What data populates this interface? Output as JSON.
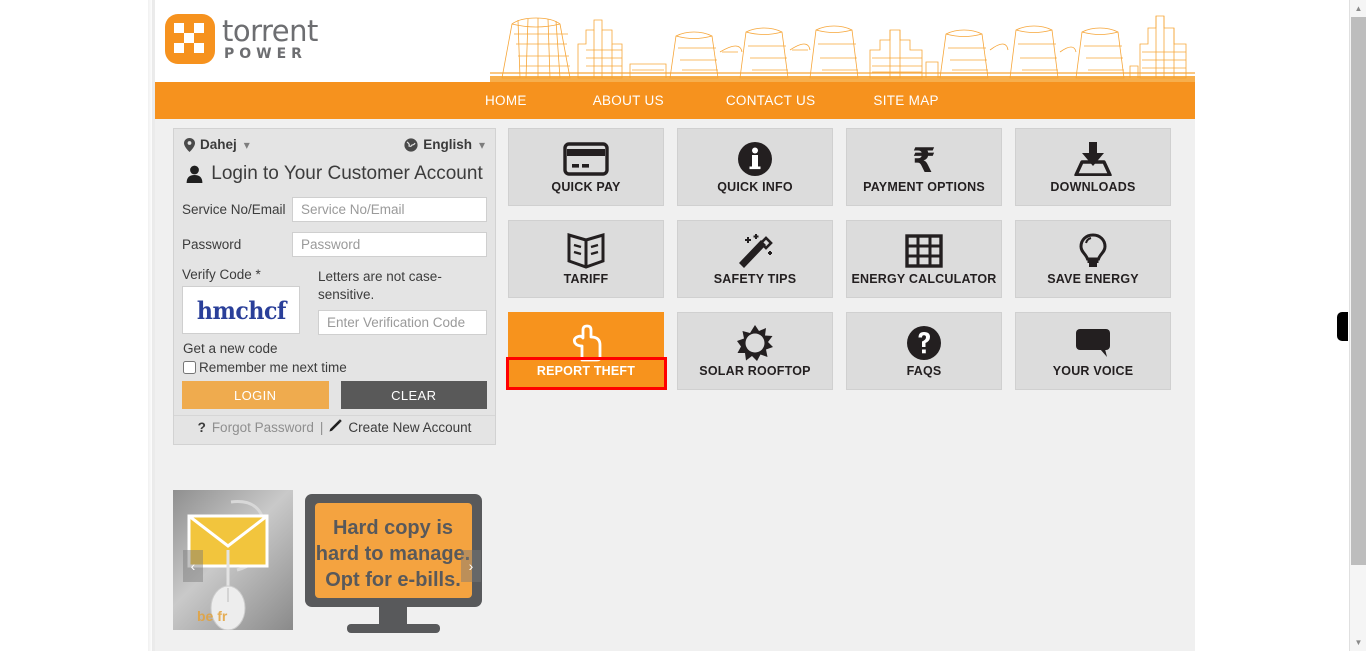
{
  "brand": {
    "logo_name": "torrent",
    "logo_sub": "POWER"
  },
  "nav": {
    "items": [
      {
        "label": "HOME"
      },
      {
        "label": "ABOUT US"
      },
      {
        "label": "CONTACT US"
      },
      {
        "label": "SITE MAP"
      }
    ]
  },
  "login": {
    "city": "Dahej",
    "language": "English",
    "title": "Login to Your Customer Account",
    "service_label": "Service No/Email",
    "service_placeholder": "Service No/Email",
    "service_value": "",
    "password_label": "Password",
    "password_placeholder": "Password",
    "password_value": "",
    "verify_label": "Verify Code *",
    "captcha_text": "hmchcf",
    "captcha_color": "#2a3f99",
    "verify_note": "Letters are not case-sensitive.",
    "verify_placeholder": "Enter Verification Code",
    "verify_value": "",
    "new_code": "Get a new code",
    "remember": "Remember me next time",
    "login_button": "LOGIN",
    "clear_button": "CLEAR",
    "forgot_password": "Forgot Password",
    "separator": "|",
    "create_account": "Create New Account",
    "question_mark": "?"
  },
  "carousel": {
    "prev": "‹",
    "next": "›",
    "slide1_caption": "be fr",
    "slide2_line1": "Hard copy is",
    "slide2_line2": "hard to manage.",
    "slide2_line3": "Opt for e-bills."
  },
  "tiles": [
    {
      "label": "QUICK PAY",
      "icon": "credit-card-icon",
      "active": false
    },
    {
      "label": "QUICK INFO",
      "icon": "info-circle-icon",
      "active": false
    },
    {
      "label": "PAYMENT OPTIONS",
      "icon": "rupee-icon",
      "active": false
    },
    {
      "label": "DOWNLOADS",
      "icon": "download-icon",
      "active": false
    },
    {
      "label": "TARIFF",
      "icon": "open-book-icon",
      "active": false
    },
    {
      "label": "SAFETY TIPS",
      "icon": "magic-wand-icon",
      "active": false
    },
    {
      "label": "ENERGY CALCULATOR",
      "icon": "grid-table-icon",
      "active": false
    },
    {
      "label": "SAVE ENERGY",
      "icon": "light-bulb-icon",
      "active": false
    },
    {
      "label": "REPORT THEFT",
      "icon": "pointing-hand-icon",
      "active": true
    },
    {
      "label": "SOLAR ROOFTOP",
      "icon": "sun-icon",
      "active": false
    },
    {
      "label": "FAQS",
      "icon": "question-circle-icon",
      "active": false
    },
    {
      "label": "YOUR VOICE",
      "icon": "speech-bubble-icon",
      "active": false
    }
  ],
  "colors": {
    "brand_orange": "#f6921e",
    "tile_gray": "#dcdcdc",
    "highlight_red": "#ff0000",
    "login_button": "#efab4e",
    "clear_button": "#595959"
  }
}
